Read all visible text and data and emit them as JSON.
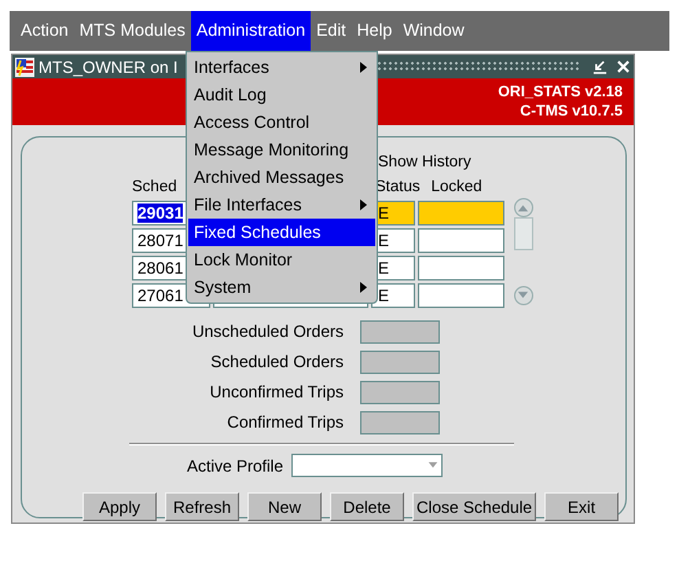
{
  "menu_bar": [
    {
      "label": "Action",
      "selected": false
    },
    {
      "label": "MTS Modules",
      "selected": false
    },
    {
      "label": "Administration",
      "selected": true
    },
    {
      "label": "Edit",
      "selected": false
    },
    {
      "label": "Help",
      "selected": false
    },
    {
      "label": "Window",
      "selected": false
    }
  ],
  "dropdown_menu": [
    {
      "label": "Interfaces",
      "submenu": true,
      "selected": false
    },
    {
      "label": "Audit Log",
      "submenu": false,
      "selected": false
    },
    {
      "label": "Access Control",
      "submenu": false,
      "selected": false
    },
    {
      "label": "Message Monitoring",
      "submenu": false,
      "selected": false
    },
    {
      "label": "Archived Messages",
      "submenu": false,
      "selected": false
    },
    {
      "label": "File Interfaces",
      "submenu": true,
      "selected": false
    },
    {
      "label": "Fixed Schedules",
      "submenu": false,
      "selected": true
    },
    {
      "label": "Lock Monitor",
      "submenu": false,
      "selected": false
    },
    {
      "label": "System",
      "submenu": true,
      "selected": false
    }
  ],
  "window": {
    "title": "MTS_OWNER on I",
    "banner": [
      "ORI_STATS v2.18",
      "C-TMS v10.7.5"
    ]
  },
  "show_history": {
    "label": "Show History"
  },
  "table": {
    "columns": [
      "Sched",
      "",
      "Status",
      "Locked"
    ],
    "rows": [
      {
        "cells": [
          "29031",
          "",
          "E",
          ""
        ],
        "selected": true
      },
      {
        "cells": [
          "28071",
          "",
          "E",
          ""
        ],
        "selected": false
      },
      {
        "cells": [
          "28061",
          "",
          "E",
          ""
        ],
        "selected": false
      },
      {
        "cells": [
          "27061",
          "",
          "E",
          ""
        ],
        "selected": false
      }
    ]
  },
  "summary": [
    {
      "label": "Unscheduled Orders"
    },
    {
      "label": "Scheduled Orders"
    },
    {
      "label": "Unconfirmed Trips"
    },
    {
      "label": "Confirmed Trips"
    }
  ],
  "active_profile": {
    "label": "Active Profile"
  },
  "buttons": [
    {
      "label": "Apply"
    },
    {
      "label": "Refresh"
    },
    {
      "label": "New"
    },
    {
      "label": "Delete"
    },
    {
      "label": "Close Schedule"
    },
    {
      "label": "Exit"
    }
  ]
}
